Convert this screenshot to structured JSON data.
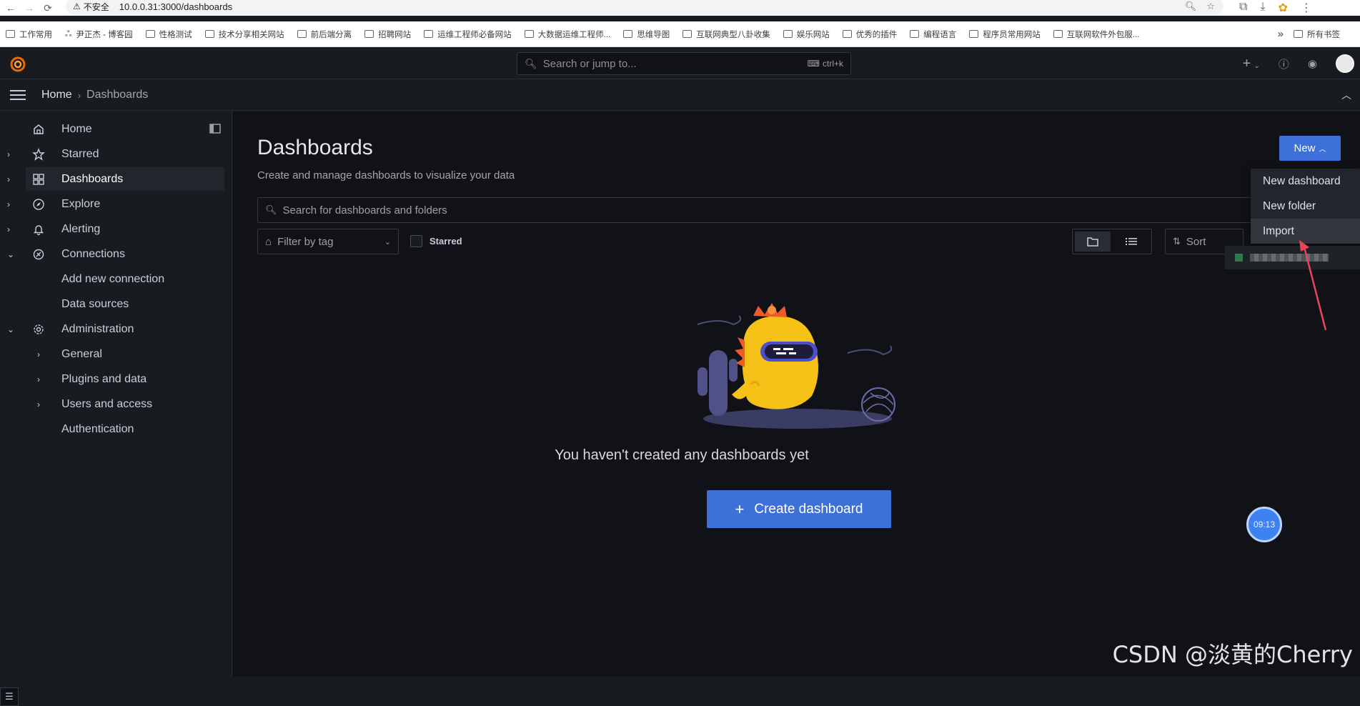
{
  "browser": {
    "security_label": "不安全",
    "url": "10.0.0.31:3000/dashboards",
    "bookmarks": [
      "工作常用",
      "尹正杰 - 博客园",
      "性格测试",
      "技术分享相关网站",
      "前后端分离",
      "招聘网站",
      "运维工程师必备网站",
      "大数据运维工程师...",
      "思维导图",
      "互联网典型八卦收集",
      "娱乐网站",
      "优秀的插件",
      "编程语言",
      "程序员常用网站",
      "互联网软件外包服..."
    ],
    "bookmarks_overflow": "»",
    "all_bookmarks": "所有书签"
  },
  "topbar": {
    "search_placeholder": "Search or jump to...",
    "search_shortcut": "ctrl+k",
    "add_label": "+"
  },
  "breadcrumb": {
    "home": "Home",
    "current": "Dashboards"
  },
  "sidebar": {
    "items": [
      {
        "label": "Home"
      },
      {
        "label": "Starred"
      },
      {
        "label": "Dashboards"
      },
      {
        "label": "Explore"
      },
      {
        "label": "Alerting"
      },
      {
        "label": "Connections"
      },
      {
        "label": "Add new connection"
      },
      {
        "label": "Data sources"
      },
      {
        "label": "Administration"
      },
      {
        "label": "General"
      },
      {
        "label": "Plugins and data"
      },
      {
        "label": "Users and access"
      },
      {
        "label": "Authentication"
      }
    ]
  },
  "main": {
    "title": "Dashboards",
    "subtitle": "Create and manage dashboards to visualize your data",
    "new_button": "New",
    "search_placeholder": "Search for dashboards and folders",
    "filter_tag": "Filter by tag",
    "starred_label": "Starred",
    "sort_label": "Sort",
    "empty_message": "You haven't created any dashboards yet",
    "create_button": "Create dashboard"
  },
  "new_menu": {
    "items": [
      "New dashboard",
      "New folder",
      "Import"
    ],
    "highlighted": "Import"
  },
  "overlay": {
    "clock_badge": "09:13",
    "watermark": "CSDN @淡黄的Cherry"
  },
  "colors": {
    "accent": "#3d71d9",
    "background": "#111217",
    "sidebar": "#181b1f",
    "arrow": "#e8455a"
  }
}
